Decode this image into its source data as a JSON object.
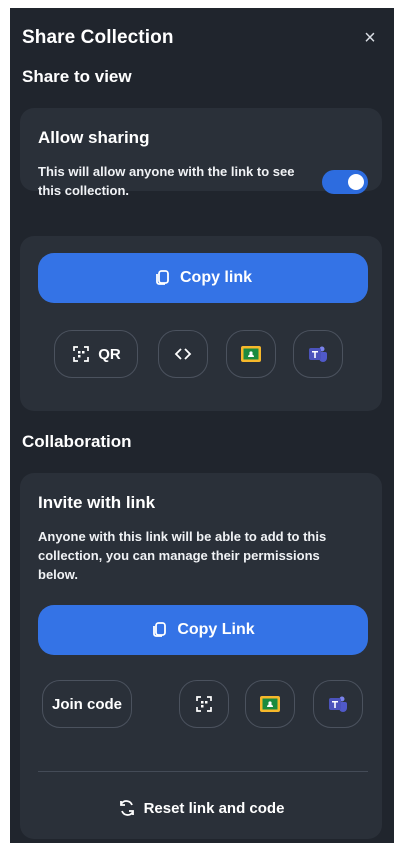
{
  "panel": {
    "title": "Share Collection",
    "close_icon": "close-icon"
  },
  "share_to_view": {
    "section_title": "Share to view",
    "allow_sharing": {
      "title": "Allow sharing",
      "description_line1": "This will allow anyone with the link to see",
      "description_line2": "this collection.",
      "toggle_on": true
    },
    "copy_link_label": "Copy link",
    "qr_label": "QR",
    "icons": [
      "qr-code-icon",
      "embed-code-icon",
      "google-classroom-icon",
      "microsoft-teams-icon"
    ]
  },
  "collaboration": {
    "section_title": "Collaboration",
    "invite": {
      "title": "Invite with link",
      "description_line1": "Anyone with this link will be able to add to this",
      "description_line2": "collection, you can manage their permissions",
      "description_line3": "below."
    },
    "copy_link_label": "Copy Link",
    "join_code_label": "Join code",
    "reset_label": "Reset link and code"
  },
  "colors": {
    "panel_background": "#20252d",
    "card_background": "#2a3039",
    "accent_blue": "#3473e6"
  }
}
